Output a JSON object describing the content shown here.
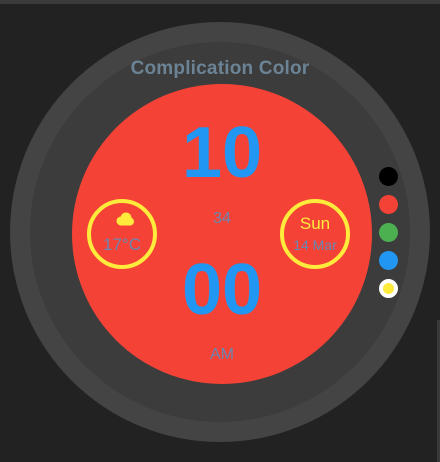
{
  "screen": {
    "title": "Complication Color"
  },
  "time": {
    "hour": "10",
    "minute": "00",
    "seconds": "34",
    "ampm": "AM"
  },
  "complications": {
    "weather": {
      "icon": "cloud-icon",
      "temperature": "17°C"
    },
    "date": {
      "day": "Sun",
      "date": "14 Mar"
    }
  },
  "color_options": [
    {
      "name": "black",
      "color": "#000000",
      "selected": false
    },
    {
      "name": "red",
      "color": "#f44336",
      "selected": false
    },
    {
      "name": "green",
      "color": "#4caf50",
      "selected": false
    },
    {
      "name": "blue",
      "color": "#2196f3",
      "selected": false
    },
    {
      "name": "yellow",
      "color": "#ffeb3b",
      "selected": true
    }
  ],
  "colors": {
    "face": "#f44336",
    "time_text": "#2196f3",
    "complication_accent": "#ffeb3b",
    "secondary_text": "#6b86b0"
  }
}
